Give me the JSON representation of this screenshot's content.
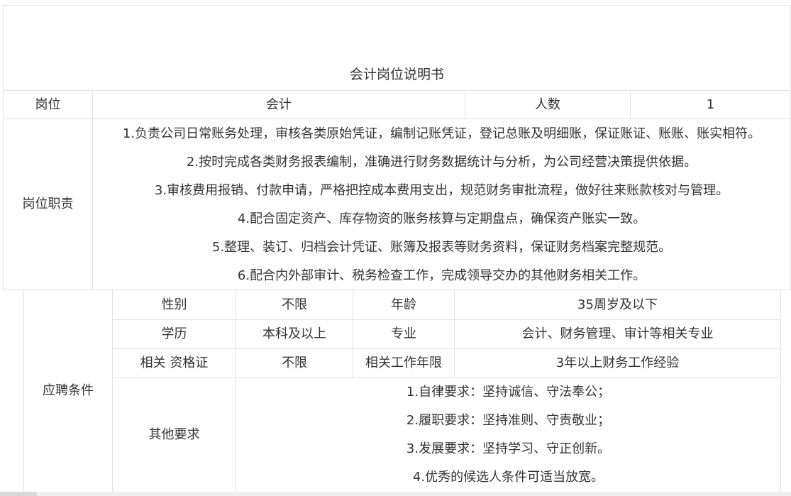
{
  "title": "会计岗位说明书",
  "row_position": {
    "label": "岗位",
    "value": "会计",
    "count_label": "人数",
    "count_value": "1"
  },
  "duties": {
    "label": "岗位职责",
    "items": [
      "1.负责公司日常账务处理，审核各类原始凭证，编制记账凭证，登记总账及明细账，保证账证、账账、账实相符。",
      "2.按时完成各类财务报表编制，准确进行财务数据统计与分析，为公司经营决策提供依据。",
      "3.审核费用报销、付款申请，严格把控成本费用支出，规范财务审批流程，做好往来账款核对与管理。",
      "4.配合固定资产、库存物资的账务核算与定期盘点，确保资产账实一致。",
      "5.整理、装订、归档会计凭证、账簿及报表等财务资料，保证财务档案完整规范。",
      "6.配合内外部审计、税务检查工作，完成领导交办的其他财务相关工作。"
    ]
  },
  "requirements": {
    "label": "应聘条件",
    "gender_label": "性别",
    "gender_value": "不限",
    "age_label": "年龄",
    "age_value": "35周岁及以下",
    "education_label": "学历",
    "education_value": "本科及以上",
    "major_label": "专业",
    "major_value": "会计、财务管理、审计等相关专业",
    "cert_label": "相关 资格证",
    "cert_value": "不限",
    "years_label": "相关工作年限",
    "years_value": "3年以上财务工作经验",
    "other_label": "其他要求",
    "other_items": [
      "1.自律要求：坚持诚信、守法奉公；",
      "2.履职要求：坚持准则、守责敬业；",
      "3.发展要求：坚持学习、守正创新。",
      "4.优秀的候选人条件可适当放宽。"
    ]
  }
}
